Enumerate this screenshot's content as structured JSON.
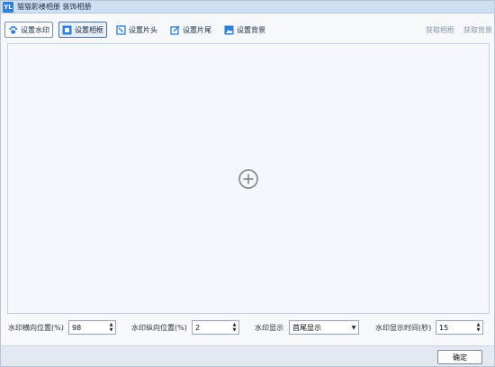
{
  "window": {
    "logo_text": "YL",
    "title": "猫猫影楼相册 装饰相册"
  },
  "toolbar": {
    "buttons": [
      {
        "label": "设置水印",
        "icon": "paw-icon"
      },
      {
        "label": "设置相框",
        "icon": "frame-icon"
      },
      {
        "label": "设置片头",
        "icon": "clip-start-icon"
      },
      {
        "label": "设置片尾",
        "icon": "clip-end-icon"
      },
      {
        "label": "设置背景",
        "icon": "image-icon"
      }
    ],
    "links": [
      "获取相框",
      "获取背景"
    ]
  },
  "canvas": {
    "add_icon": "add-circle-icon"
  },
  "settings": {
    "h_pos_label": "水印横向位置(%)",
    "h_pos_value": "98",
    "v_pos_label": "水印纵向位置(%)",
    "v_pos_value": "2",
    "display_label": "水印显示",
    "display_value": "首尾显示",
    "time_label": "水印显示时间(秒)",
    "time_value": "15"
  },
  "footer": {
    "ok_label": "确定"
  },
  "colors": {
    "accent": "#2f7fd8",
    "titlebar": "#cfe0f5",
    "canvas": "#f4f8fd"
  }
}
